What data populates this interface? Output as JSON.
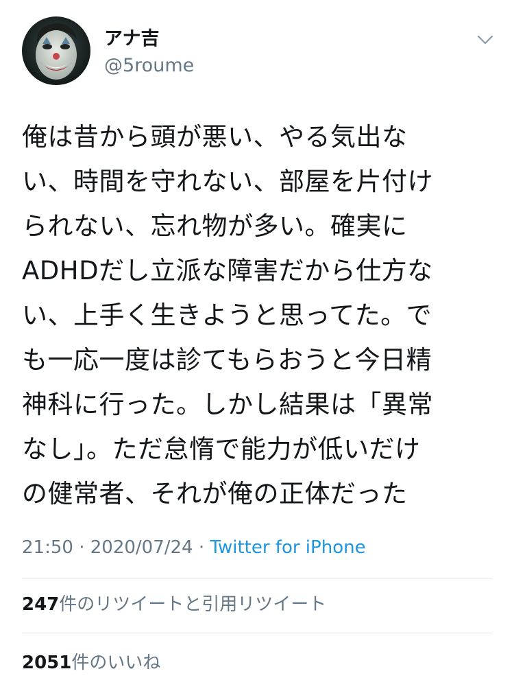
{
  "user": {
    "display_name": "アナ吉",
    "handle": "@5roume"
  },
  "tweet": {
    "text": "俺は昔から頭が悪い、やる気出な\nい、時間を守れない、部屋を片付け\nられない、忘れ物が多い。確実に\nADHDだし立派な障害だから仕方な\nい、上手く生きようと思ってた。で\nも一応一度は診てもらおうと今日精\n神科に行った。しかし結果は「異常\nなし」。ただ怠惰で能力が低いだけ\nの健常者、それが俺の正体だった"
  },
  "meta": {
    "time": "21:50",
    "separator1": " · ",
    "date": "2020/07/24",
    "separator2": " · ",
    "source": "Twitter for iPhone"
  },
  "stats": {
    "retweet_count": "247",
    "retweet_label": "件のリツイートと引用リツイート",
    "like_count": "2051",
    "like_label": "件のいいね"
  },
  "icons": {
    "menu": "chevron-down-icon",
    "avatar": "avatar-image"
  },
  "colors": {
    "text_primary": "#14171a",
    "text_secondary": "#657786",
    "link": "#1b95e0",
    "divider": "#dfe3e6"
  }
}
